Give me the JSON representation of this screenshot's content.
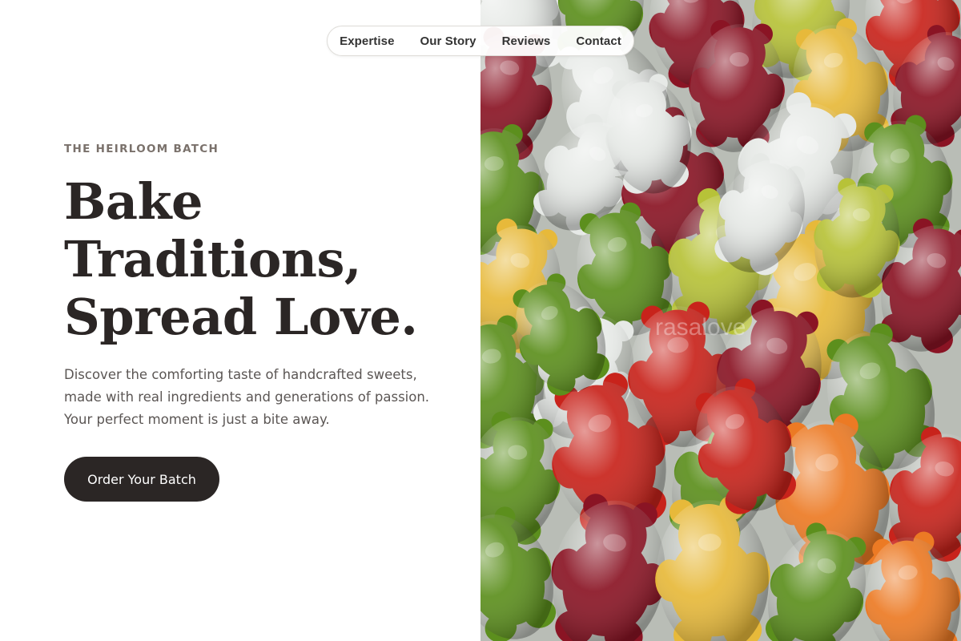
{
  "nav": {
    "items": [
      {
        "label": "Expertise"
      },
      {
        "label": "Our Story"
      },
      {
        "label": "Reviews"
      },
      {
        "label": "Contact"
      }
    ]
  },
  "hero": {
    "eyebrow": "THE HEIRLOOM BATCH",
    "headline_lines": [
      "Bake",
      "Traditions,",
      "Spread Love."
    ],
    "lede": "Discover the comforting taste of handcrafted sweets, made with real ingredients and generations of passion. Your perfect moment is just a bite away.",
    "cta_label": "Order Your Batch"
  },
  "image": {
    "subject": "gummy-bears-photo",
    "watermark": "rasalove",
    "gummy_colors": {
      "red": "#c8231b",
      "crimson": "#8a1424",
      "green": "#5c8f1d",
      "yellow": "#e7b93a",
      "orange": "#ec7a24",
      "clear": "#e6e9e6",
      "lime": "#b7c238"
    }
  },
  "colors": {
    "text_dark": "#2b2625",
    "text_muted": "#5b5654",
    "eyebrow": "#7a716b",
    "cta_bg": "#2b2625",
    "cta_text": "#ffffff",
    "page_bg": "#ffffff"
  }
}
